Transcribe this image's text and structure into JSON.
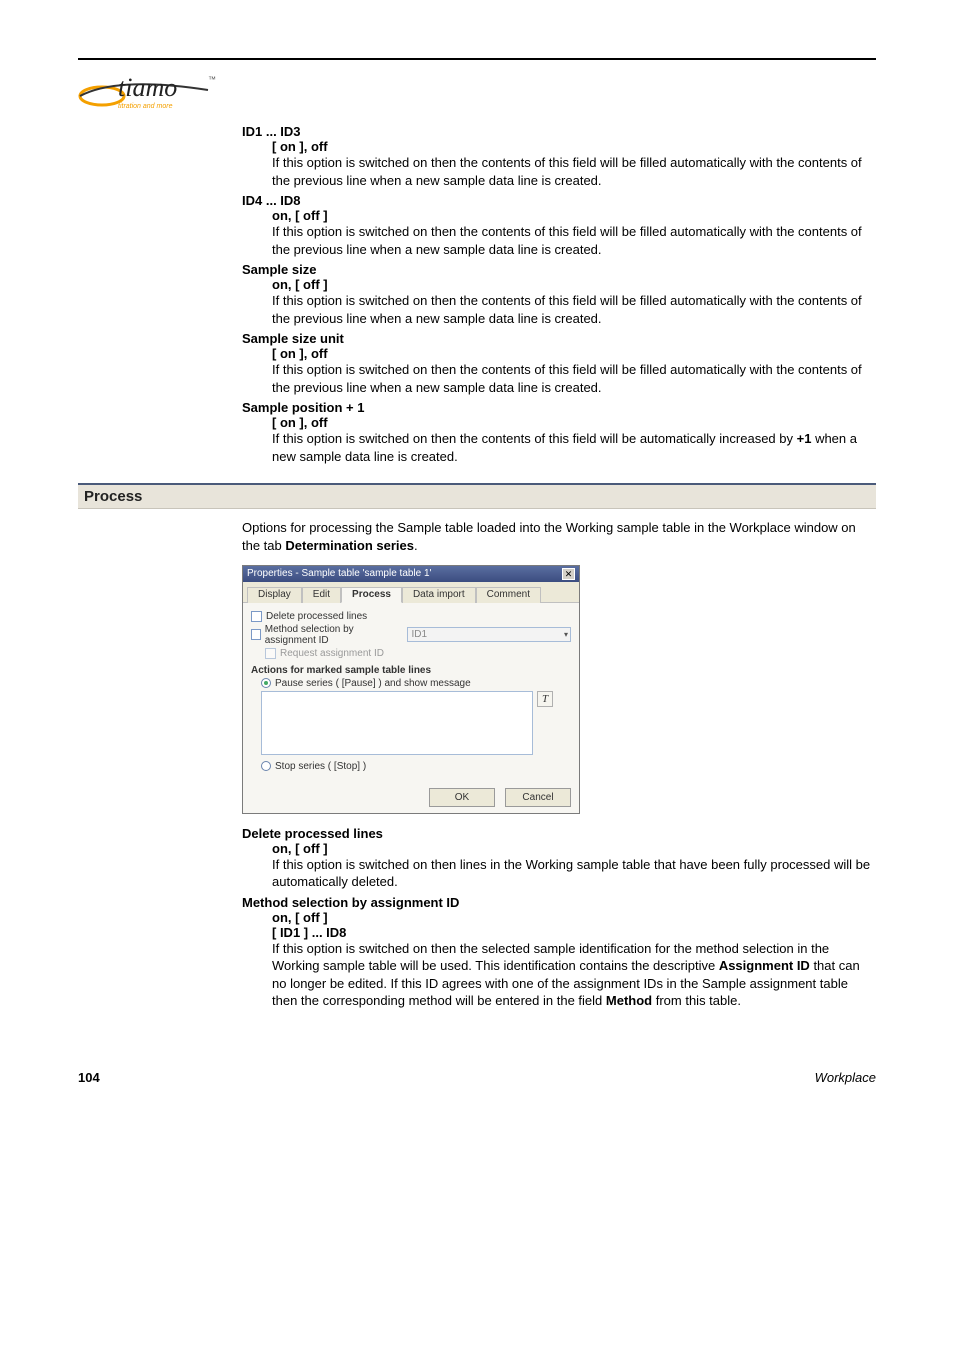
{
  "logo": {
    "brand": "tiamo",
    "tagline": "titration and more",
    "tm": "™"
  },
  "sections": {
    "preDefs": [
      {
        "term": "ID1 ... ID3",
        "sub": "[ on ], off",
        "body": "If this option is switched on then the contents of this field will be filled automatically with the contents of the previous line when a new sample data line is created."
      },
      {
        "term": "ID4 ... ID8",
        "sub": "on, [ off ]",
        "body": "If this option is switched on then the contents of this field will be filled automatically with the contents of the previous line when a new sample data line is created."
      },
      {
        "term": "Sample size",
        "sub": "on, [ off ]",
        "body": "If this option is switched on then the contents of this field will be filled automatically with the contents of the previous line when a new sample data line is created."
      },
      {
        "term": "Sample size unit",
        "sub": "[ on ], off",
        "body": "If this option is switched on then the contents of this field will be filled automatically with the contents of the previous line when a new sample data line is created."
      },
      {
        "term": "Sample position + 1",
        "sub": "[ on ], off",
        "body_pre": "If this option is switched on then the contents of this field will be automatically increased by ",
        "body_bold": "+1",
        "body_post": " when a new sample data line is created."
      }
    ],
    "processHeading": "Process",
    "processIntro_pre": "Options for processing the Sample table loaded into the Working sample table in the Workplace window on the tab ",
    "processIntro_bold": "Determination series",
    "processIntro_post": ".",
    "postDefs": [
      {
        "term": "Delete processed lines",
        "sub": "on, [ off ]",
        "body": "If this option is switched on then lines in the Working sample table that have been fully processed will be automatically deleted."
      },
      {
        "term": "Method selection by assignment ID",
        "sub": "on, [ off ]",
        "sub2": "[ ID1 ] ... ID8",
        "body_pre": "If this option is switched on then the selected sample identification for the method selection in the Working sample table will be used. This identification contains the descriptive ",
        "body_bold1": "Assignment ID",
        "body_mid": " that can no longer be edited. If this ID agrees with one of the assignment IDs in the Sample assignment table then the corresponding method will be entered in the field ",
        "body_bold2": "Method",
        "body_post": " from this table."
      }
    ]
  },
  "dialog": {
    "title": "Properties - Sample table 'sample table 1'",
    "tabs": {
      "display": "Display",
      "edit": "Edit",
      "process": "Process",
      "dataimport": "Data import",
      "comment": "Comment"
    },
    "cb_delete": "Delete processed lines",
    "cb_method": "Method selection by assignment ID",
    "dd_value": "ID1",
    "cb_request": "Request assignment ID",
    "group": "Actions for marked sample table lines",
    "radio_pause": "Pause series ( [Pause] ) and show message",
    "italic_btn": "T",
    "radio_stop": "Stop series ( [Stop] )",
    "ok": "OK",
    "cancel": "Cancel",
    "close_glyph": "✕"
  },
  "footer": {
    "page": "104",
    "location": "Workplace"
  }
}
